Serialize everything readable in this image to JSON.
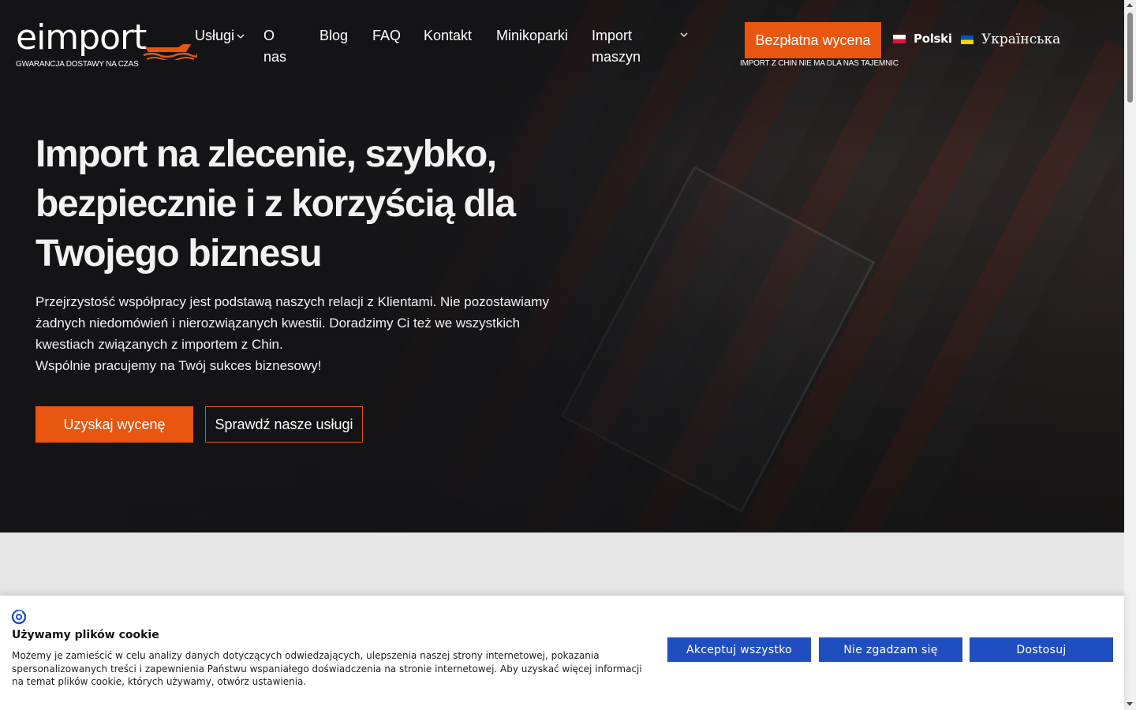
{
  "header": {
    "logo_text": "eimport",
    "logo_tagline": "GWARANCJA DOSTAWY NA CZAS",
    "nav": [
      {
        "label": "Usługi"
      },
      {
        "label": "O nas"
      },
      {
        "label": "Blog"
      },
      {
        "label": "FAQ"
      },
      {
        "label": "Kontakt"
      },
      {
        "label": "Minikoparki"
      },
      {
        "label": "Import maszyn"
      }
    ],
    "cta_label": "Bezpłatna wycena",
    "cta_tagline": "IMPORT Z CHIN NIE MA DLA NAS TAJEMNIC",
    "languages": [
      {
        "label": "Polski",
        "flag": "flag-poland-icon"
      },
      {
        "label": "Українська",
        "flag": "flag-ukraine-icon"
      }
    ]
  },
  "hero": {
    "title": "Import na zlecenie, szybko, bezpiecznie i z korzyścią dla Twojego biznesu",
    "description_lines": [
      "Przejrzystość współpracy jest podstawą naszych relacji z Klientami. Nie pozostawiamy żadnych niedomówień i nierozwiązanych kwestii. Doradzimy Ci też we wszystkich kwestiach związanych z importem z Chin.",
      "Wspólnie pracujemy na Twój sukces biznesowy!"
    ],
    "primary_button": "Uzyskaj wycenę",
    "secondary_button": "Sprawdź nasze usługi"
  },
  "cookie_banner": {
    "title": "Używamy plików cookie",
    "text": "Możemy je zamieścić w celu analizy danych dotyczących odwiedzających, ulepszenia naszej strony internetowej, pokazania spersonalizowanych treści i zapewnienia Państwu wspaniałego doświadczenia na stronie internetowej. Aby uzyskać więcej informacji na temat plików cookie, których używamy, otwórz ustawienia.",
    "accept_all": "Akceptuj wszystko",
    "reject": "Nie zgadzam się",
    "customize": "Dostosuj"
  },
  "colors": {
    "accent": "#e8560f",
    "cookie_button": "#1f4fbf",
    "hero_text": "#f2f2f2"
  }
}
